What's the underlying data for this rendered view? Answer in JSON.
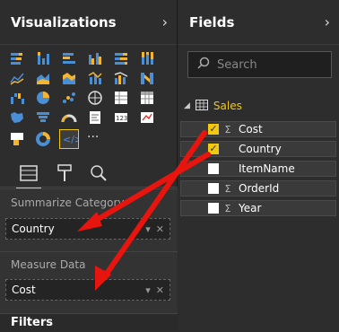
{
  "visualizations": {
    "title": "Visualizations",
    "more": "···",
    "summarize_label": "Summarize Category",
    "summarize_value": "Country",
    "measure_label": "Measure Data",
    "measure_value": "Cost",
    "filters_label": "Filters"
  },
  "fields": {
    "title": "Fields",
    "search_placeholder": "Search",
    "table_name": "Sales",
    "items": [
      {
        "label": "Cost",
        "checked": true,
        "sigma": "Σ"
      },
      {
        "label": "Country",
        "checked": true,
        "sigma": ""
      },
      {
        "label": "ItemName",
        "checked": false,
        "sigma": ""
      },
      {
        "label": "OrderId",
        "checked": false,
        "sigma": "Σ"
      },
      {
        "label": "Year",
        "checked": false,
        "sigma": "Σ"
      }
    ]
  },
  "colors": {
    "accent": "#f2c811",
    "arrow": "#e8140e",
    "panel": "#2d2d2d"
  },
  "icons": [
    "stacked-bar",
    "stacked-column",
    "clustered-bar",
    "clustered-column",
    "100-bar",
    "100-column",
    "line",
    "area",
    "stacked-area",
    "line-column",
    "line-clustered",
    "ribbon",
    "waterfall",
    "scatter",
    "pie",
    "donut-hollow",
    "treemap",
    "map",
    "filled-map",
    "funnel",
    "gauge",
    "card",
    "multi-row-card",
    "kpi",
    "slicer",
    "table",
    "matrix",
    "r-visual",
    "custom-visual"
  ]
}
